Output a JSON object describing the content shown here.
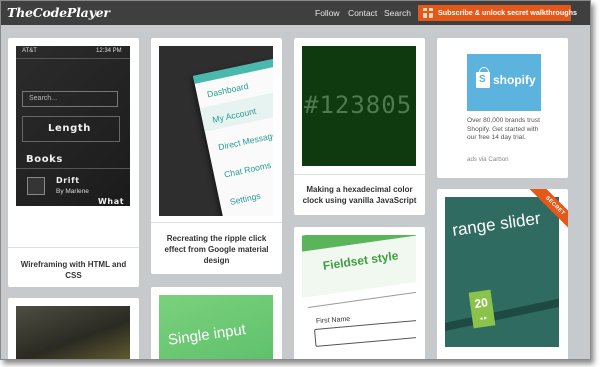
{
  "header": {
    "logo": "TheCodePlayer",
    "nav": [
      "Follow",
      "Contact",
      "Search"
    ],
    "subscribe_label": "Subscribe & unlock secret walkthroughs"
  },
  "cards": {
    "wireframing": {
      "caption": "Wireframing with HTML and CSS",
      "thumb": {
        "carrier": "AT&T",
        "clock": "12:34 PM",
        "search_placeholder": "Search...",
        "length_label": "Length",
        "books_label": "Books",
        "drift_title": "Drift",
        "drift_author": "By Marlene",
        "what_label": "What"
      }
    },
    "ripple": {
      "caption": "Recreating the ripple click effect from Google material design",
      "menu": [
        "Dashboard",
        "My Account",
        "Direct Message",
        "Chat Rooms",
        "Settings"
      ]
    },
    "hexclock": {
      "caption": "Making a hexadecimal color clock using vanilla JavaScript",
      "thumb_text": "#123805"
    },
    "ad": {
      "brand": "shopify",
      "text": "Over 80,000 brands trust Shopify. Get started with our free 14 day trial.",
      "via": "ads via Carbon"
    },
    "range_slider": {
      "title": "range slider",
      "ribbon": "SECRET",
      "value": "20",
      "arrows": "◂ ▸"
    },
    "fieldset": {
      "title": "Fieldset style",
      "label": "First Name"
    },
    "single_input": {
      "title": "Single input"
    }
  },
  "colors": {
    "header_bg": "#3f3f3f",
    "page_bg": "#c6cacd",
    "accent_orange": "#e4591a",
    "teal": "#2a9d94",
    "hex_clock_bg": "#0f3a0f",
    "shopify_blue": "#5bb3de"
  }
}
